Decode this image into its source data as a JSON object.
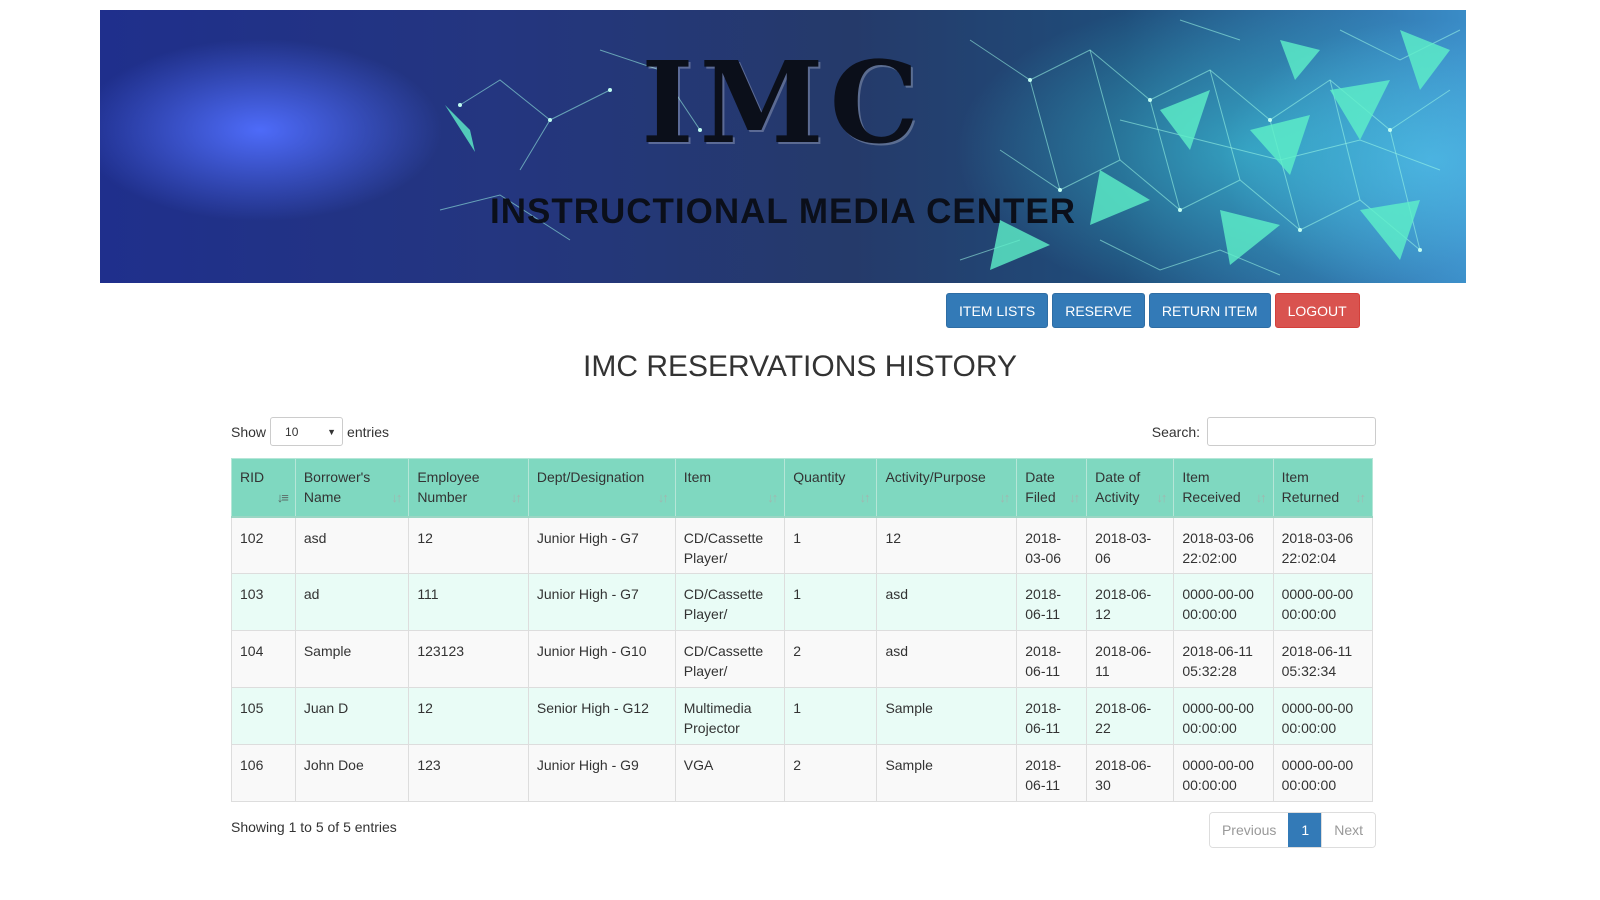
{
  "banner": {
    "logo_text": "IMC",
    "subtitle": "INSTRUCTIONAL MEDIA CENTER"
  },
  "nav": {
    "item_lists": "ITEM LISTS",
    "reserve": "RESERVE",
    "return_item": "RETURN ITEM",
    "logout": "LOGOUT"
  },
  "page": {
    "title": "IMC RESERVATIONS HISTORY"
  },
  "controls": {
    "show_label": "Show",
    "entries_value": "10",
    "entries_label": "entries",
    "search_label": "Search:",
    "search_value": ""
  },
  "table": {
    "columns": [
      "RID",
      "Borrower's Name",
      "Employee Number",
      "Dept/Designation",
      "Item",
      "Quantity",
      "Activity/Purpose",
      "Date Filed",
      "Date of Activity",
      "Item Received",
      "Item Returned"
    ],
    "rows": [
      [
        "102",
        "asd",
        "12",
        "Junior High - G7",
        "CD/Cassette Player/",
        "1",
        "12",
        "2018-03-06",
        "2018-03-06",
        "2018-03-06 22:02:00",
        "2018-03-06 22:02:04"
      ],
      [
        "103",
        "ad",
        "111",
        "Junior High - G7",
        "CD/Cassette Player/",
        "1",
        "asd",
        "2018-06-11",
        "2018-06-12",
        "0000-00-00 00:00:00",
        "0000-00-00 00:00:00"
      ],
      [
        "104",
        "Sample",
        "123123",
        "Junior High - G10",
        "CD/Cassette Player/",
        "2",
        "asd",
        "2018-06-11",
        "2018-06-11",
        "2018-06-11 05:32:28",
        "2018-06-11 05:32:34"
      ],
      [
        "105",
        "Juan D",
        "12",
        "Senior High - G12",
        "Multimedia Projector",
        "1",
        "Sample",
        "2018-06-11",
        "2018-06-22",
        "0000-00-00 00:00:00",
        "0000-00-00 00:00:00"
      ],
      [
        "106",
        "John Doe",
        "123",
        "Junior High - G9",
        "VGA",
        "2",
        "Sample",
        "2018-06-11",
        "2018-06-30",
        "0000-00-00 00:00:00",
        "0000-00-00 00:00:00"
      ]
    ]
  },
  "footer": {
    "info": "Showing 1 to 5 of 5 entries",
    "previous": "Previous",
    "current_page": "1",
    "next": "Next"
  },
  "colors": {
    "header_bg": "#7fd8c0",
    "primary_button": "#337ab7",
    "danger_button": "#d9534f",
    "even_row": "#e9fcf6"
  },
  "icons": [
    "sort-icon",
    "sort-asc-icon",
    "caret-down-icon"
  ]
}
